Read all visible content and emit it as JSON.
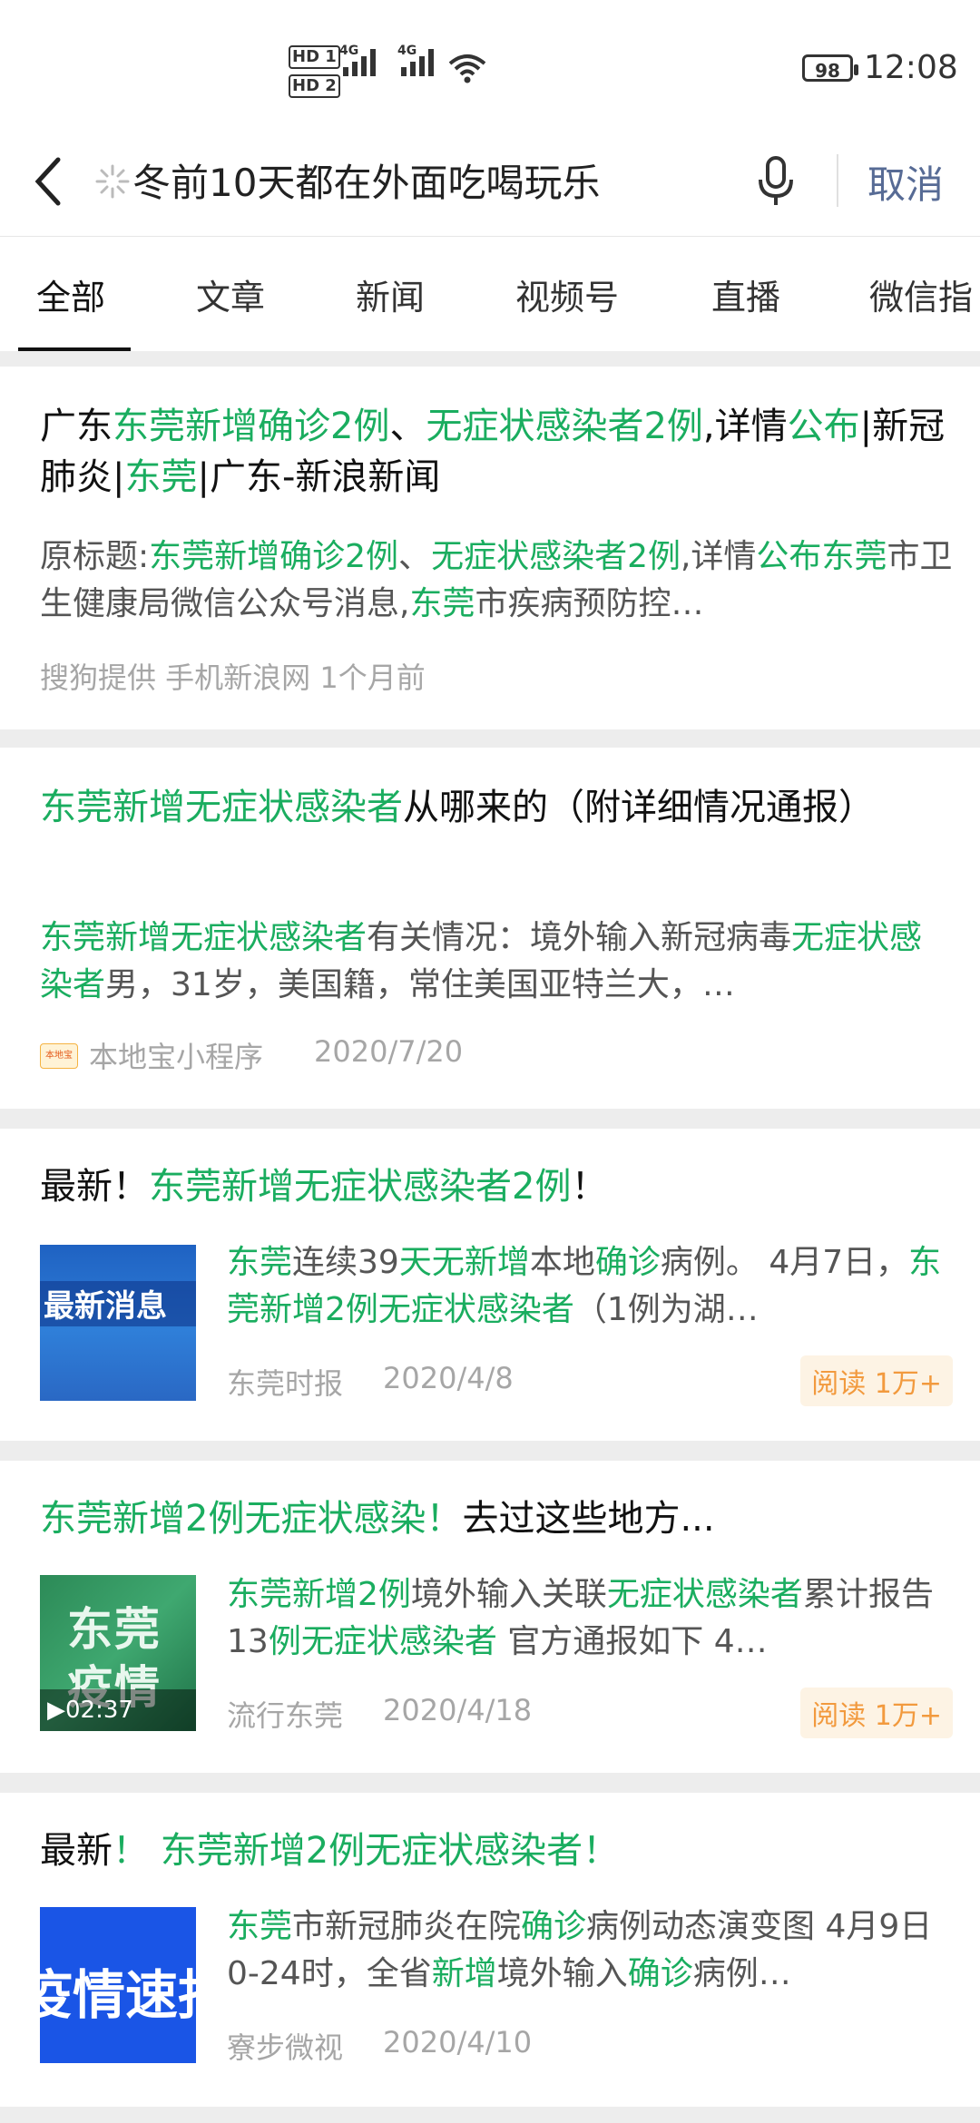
{
  "status_bar": {
    "hd1": "HD 1",
    "hd2": "HD 2",
    "net1": "4G",
    "net2": "4G",
    "battery": "98",
    "time": "12:08"
  },
  "search": {
    "query": "冬前10天都在外面吃喝玩乐",
    "cancel": "取消"
  },
  "tabs": [
    "全部",
    "文章",
    "新闻",
    "视频号",
    "直播",
    "微信指"
  ],
  "results": [
    {
      "title": "广东东莞新增确诊2例、无症状感染者2例,详情公布|新冠肺炎|东莞|广东-新浪新闻",
      "snippet": "原标题:东莞新增确诊2例、无症状感染者2例,详情公布东莞市卫生健康局微信公众号消息,东莞市疾病预防控…",
      "meta": "搜狗提供 手机新浪网 1个月前"
    },
    {
      "title": "东莞新增无症状感染者从哪来的（附详细情况通报）",
      "snippet": "东莞新增无症状感染者有关情况：境外输入新冠病毒无症状感染者男，31岁，美国籍，常住美国亚特兰大，…",
      "source": "本地宝小程序",
      "date": "2020/7/20"
    },
    {
      "title_plain": "最新！",
      "title_hl": "东莞新增无症状感染者2例",
      "title_tail": "！",
      "thumb_text": "最新消息",
      "snippet": "东莞连续39天无新增本地确诊病例。 4月7日，东莞新增2例无症状感染者（1例为湖…",
      "source": "东莞时报",
      "date": "2020/4/8",
      "read": "阅读 1万+"
    },
    {
      "title_hl": "东莞新增2例无症状感染！",
      "title_tail": "去过这些地方...",
      "thumb_text_1": "东莞",
      "thumb_text_2": "疫情",
      "duration": "▶02:37",
      "snippet": "东莞新增2例境外输入关联无症状感染者累计报告13例无症状感染者 官方通报如下 4…",
      "source": "流行东莞",
      "date": "2020/4/18",
      "read": "阅读 1万+"
    },
    {
      "title_plain": "最新",
      "title_hl": "！ 东莞新增2例无症状感染者！",
      "thumb_text": "疫情速报",
      "snippet": "东莞市新冠肺炎在院确诊病例动态演变图 4月9日0-24时，全省新增境外输入确诊病例…",
      "source": "寮步微视",
      "date": "2020/4/10"
    }
  ],
  "colors": {
    "highlight": "#1aad5f",
    "link_blue": "#576b95",
    "read_badge": "#f29a3e"
  }
}
